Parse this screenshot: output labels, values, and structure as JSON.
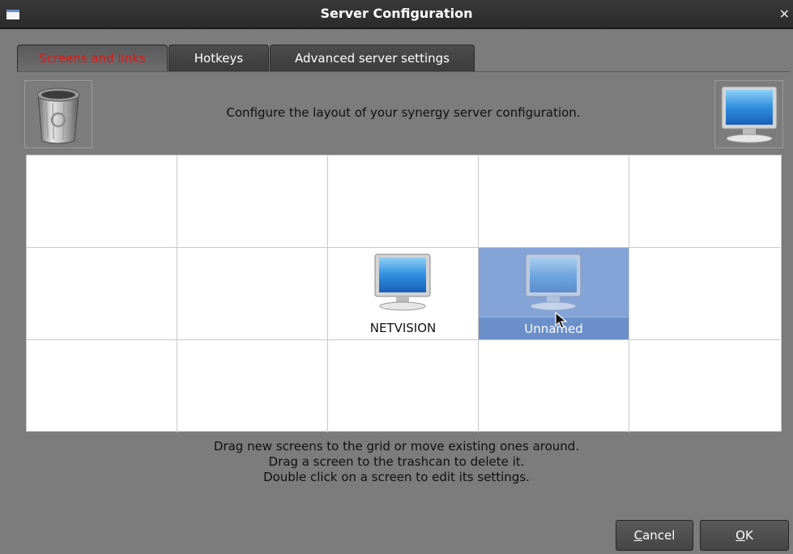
{
  "window": {
    "title": "Server Configuration",
    "close_glyph": "×"
  },
  "tabs": [
    {
      "label": "Screens and links",
      "active": true
    },
    {
      "label": "Hotkeys",
      "active": false
    },
    {
      "label": "Advanced server settings",
      "active": false
    }
  ],
  "header": {
    "text": "Configure the layout of your synergy server configuration."
  },
  "grid": {
    "rows": 3,
    "cols": 5,
    "screens": [
      {
        "name": "NETVISION",
        "row": 1,
        "col": 2,
        "selected": false
      },
      {
        "name": "Unnamed",
        "row": 1,
        "col": 3,
        "selected": true
      }
    ]
  },
  "help": {
    "line1": "Drag new screens to the grid or move existing ones around.",
    "line2": "Drag a screen to the trashcan to delete it.",
    "line3": "Double click on a screen to edit its settings."
  },
  "buttons": {
    "cancel_mnemonic": "C",
    "cancel_rest": "ancel",
    "ok_mnemonic": "O",
    "ok_rest": "K"
  },
  "colors": {
    "active_tab_text": "#e01818",
    "selection": "#84a3d6",
    "background": "#7c7c7c"
  },
  "icons": [
    "trashcan-icon",
    "monitor-icon",
    "mouse-pointer-icon"
  ]
}
